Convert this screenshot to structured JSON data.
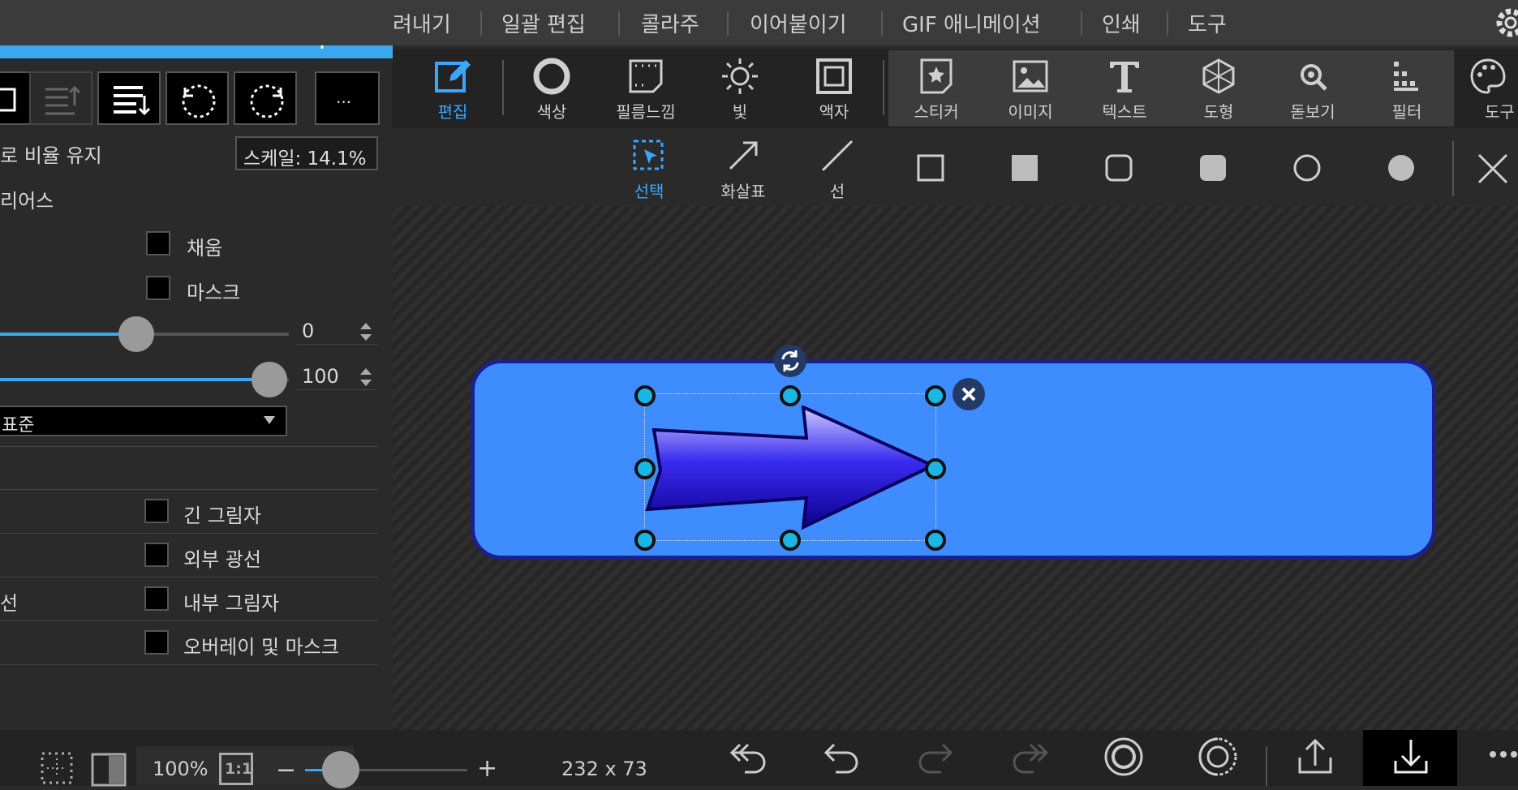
{
  "menu": {
    "items": [
      "려내기",
      "일괄 편집",
      "콜라주",
      "이어붙이기",
      "GIF 애니메이션",
      "인쇄",
      "도구"
    ]
  },
  "toolbar": {
    "tools": [
      {
        "label": "편집",
        "icon": "edit-icon"
      },
      {
        "label": "색상",
        "icon": "color-ring-icon"
      },
      {
        "label": "필름느낌",
        "icon": "film-icon"
      },
      {
        "label": "빛",
        "icon": "sun-icon"
      },
      {
        "label": "액자",
        "icon": "frame-icon"
      },
      {
        "label": "스티커",
        "icon": "sticker-icon"
      },
      {
        "label": "이미지",
        "icon": "image-icon"
      },
      {
        "label": "텍스트",
        "icon": "text-icon"
      },
      {
        "label": "도형",
        "icon": "shape-icon"
      },
      {
        "label": "돋보기",
        "icon": "magnifier-icon"
      },
      {
        "label": "필터",
        "icon": "filter-icon"
      },
      {
        "label": "도구",
        "icon": "palette-icon"
      }
    ]
  },
  "shapes": {
    "items": [
      {
        "label": "선택",
        "icon": "select-icon"
      },
      {
        "label": "화살표",
        "icon": "arrow-icon"
      },
      {
        "label": "선",
        "icon": "line-icon"
      }
    ]
  },
  "panel": {
    "keep_ratio": "로 비율 유지",
    "scale": "스케일: 14.1%",
    "series": "리어스",
    "fill": "채움",
    "mask": "마스크",
    "slider1_value": "0",
    "slider1_fraction": 0.0,
    "slider2_value": "100",
    "slider2_fraction": 1.0,
    "blend": "표준",
    "long_shadow": "긴 그림자",
    "outer_glow": "외부 광선",
    "inner_shadow_prefix": "선",
    "inner_shadow": "내부 그림자",
    "overlay_mask": "오버레이 및 마스크",
    "more": "..."
  },
  "bottom": {
    "zoom": "100%",
    "one_to_one": "1:1",
    "dimensions": "232 x 73",
    "zoom_fraction": 0.2
  },
  "colors": {
    "accent": "#3aa7f0",
    "canvas_box": "#3f8cff",
    "arrow": "#2010c8"
  }
}
